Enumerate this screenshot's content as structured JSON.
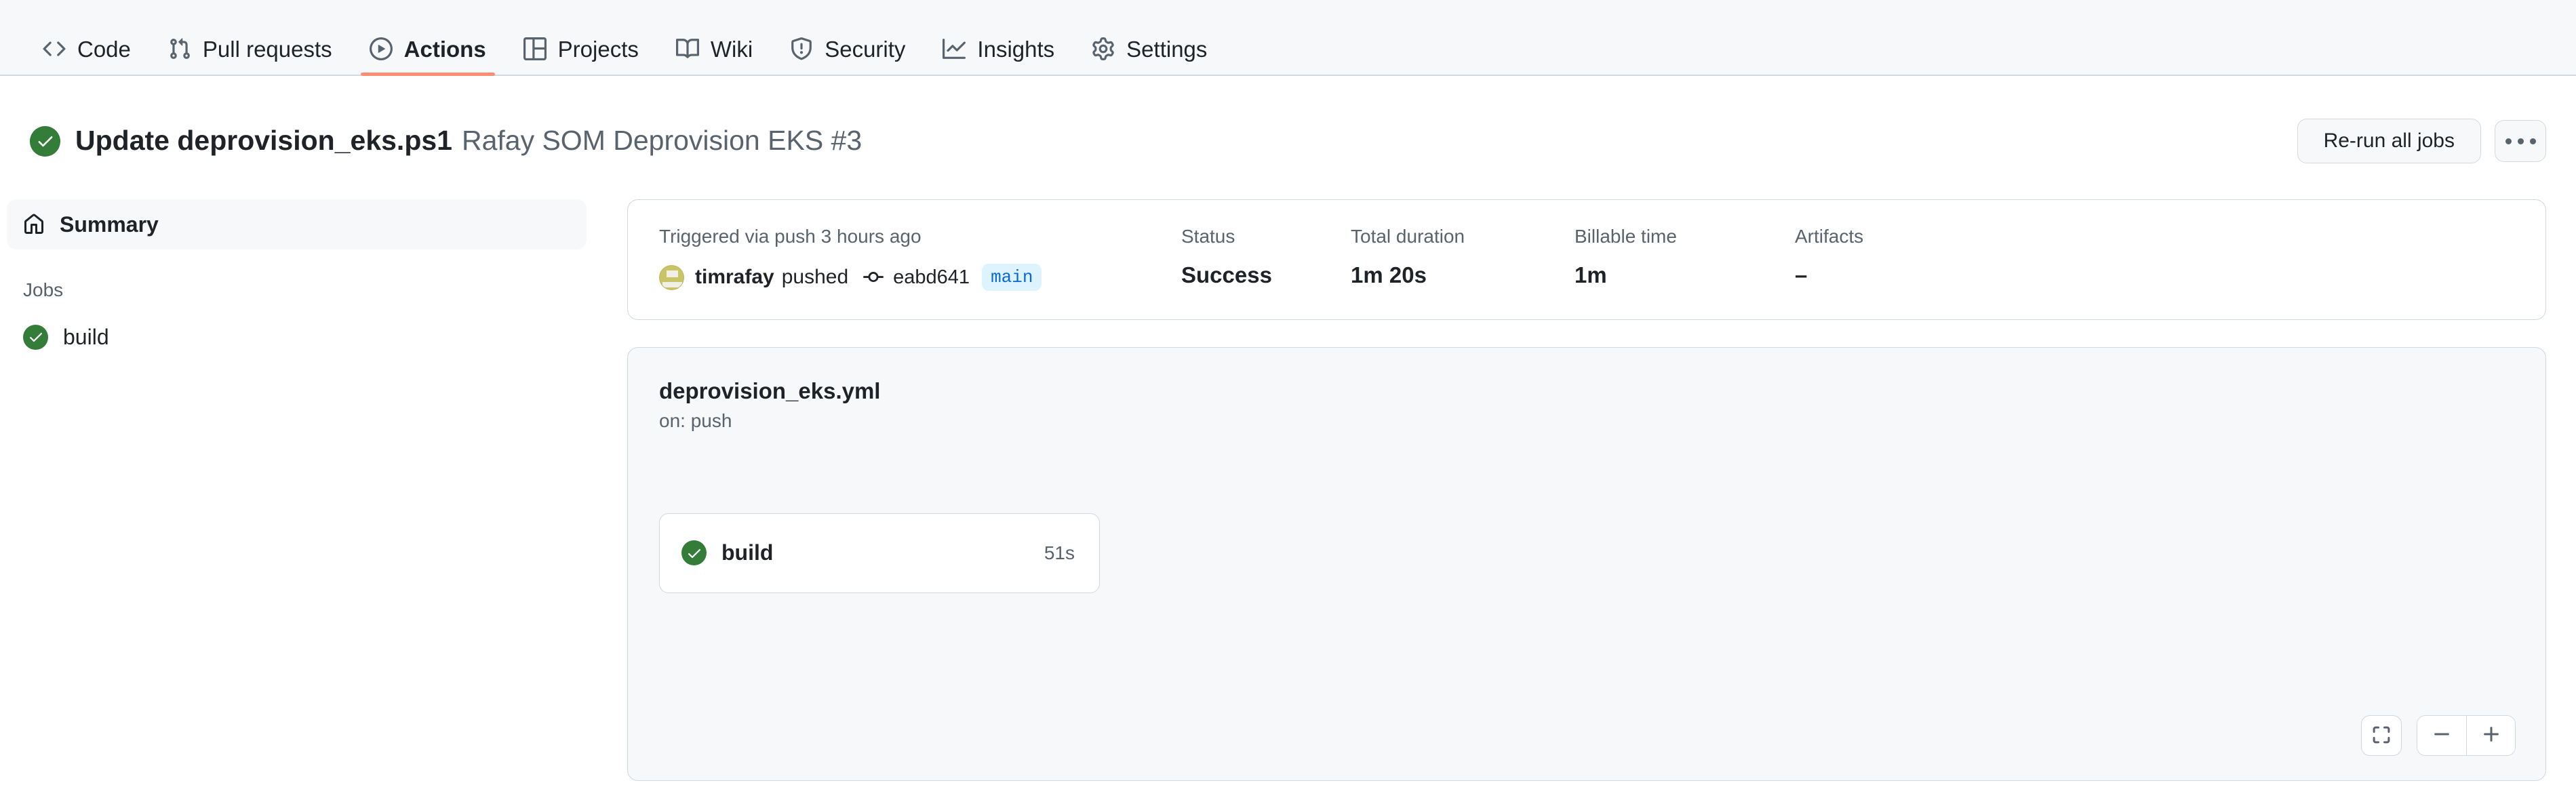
{
  "repo_nav": {
    "items": [
      {
        "label": "Code",
        "icon": "code-icon",
        "active": false
      },
      {
        "label": "Pull requests",
        "icon": "pull-request-icon",
        "active": false
      },
      {
        "label": "Actions",
        "icon": "play-circle-icon",
        "active": true
      },
      {
        "label": "Projects",
        "icon": "project-table-icon",
        "active": false
      },
      {
        "label": "Wiki",
        "icon": "book-icon",
        "active": false
      },
      {
        "label": "Security",
        "icon": "shield-icon",
        "active": false
      },
      {
        "label": "Insights",
        "icon": "graph-icon",
        "active": false
      },
      {
        "label": "Settings",
        "icon": "gear-icon",
        "active": false
      }
    ],
    "active_underline_color": "#fd8c73"
  },
  "header": {
    "status_icon": "check-circle-icon",
    "status_color": "#347d39",
    "title": "Update deprovision_eks.ps1",
    "subtitle": "Rafay SOM Deprovision EKS #3",
    "rerun_button": "Re-run all jobs",
    "more_button": "kebab-icon"
  },
  "sidebar": {
    "summary_item": {
      "label": "Summary",
      "icon": "home-icon",
      "selected": true
    },
    "jobs_heading": "Jobs",
    "jobs": [
      {
        "label": "build",
        "status": "success",
        "icon": "check-circle-icon"
      }
    ]
  },
  "summary": {
    "trigger_text": "Triggered via push 3 hours ago",
    "actor": "timrafay",
    "action_verb": "pushed",
    "commit_sha": "eabd641",
    "branch": "main",
    "branch_color": "#0969da",
    "branch_bg": "#ddf4ff",
    "stats": [
      {
        "label": "Status",
        "value": "Success"
      },
      {
        "label": "Total duration",
        "value": "1m 20s"
      },
      {
        "label": "Billable time",
        "value": "1m"
      },
      {
        "label": "Artifacts",
        "value": "–"
      }
    ]
  },
  "workflow_graph": {
    "file_name": "deprovision_eks.yml",
    "trigger": "on: push",
    "nodes": [
      {
        "name": "build",
        "duration": "51s",
        "status": "success",
        "icon": "check-circle-icon"
      }
    ],
    "controls": {
      "fullscreen": "fullscreen-icon",
      "zoom_out": "minus-icon",
      "zoom_in": "plus-icon"
    }
  }
}
